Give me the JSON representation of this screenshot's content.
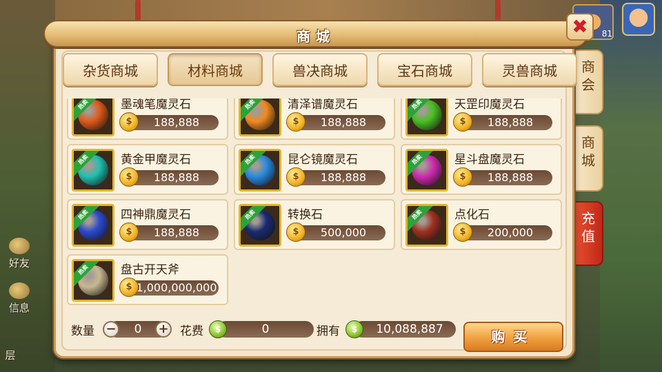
{
  "window": {
    "title": "商城",
    "close_symbol": "✖"
  },
  "background": {
    "level": "81",
    "side_icons": [
      "好友",
      "信息",
      "层"
    ]
  },
  "tabs": [
    {
      "label": "杂货商城",
      "active": false
    },
    {
      "label": "材料商城",
      "active": true
    },
    {
      "label": "兽决商城",
      "active": false
    },
    {
      "label": "宝石商城",
      "active": false
    },
    {
      "label": "灵兽商城",
      "active": false
    }
  ],
  "side_tabs": [
    {
      "label": "商会",
      "active": false
    },
    {
      "label": "商城",
      "active": false
    },
    {
      "label": "充值",
      "active": true
    }
  ],
  "items": [
    {
      "name": "墨魂笔魔灵石",
      "price": "188,888",
      "badge": "热卖",
      "color": "#e05a1a"
    },
    {
      "name": "清泽谱魔灵石",
      "price": "188,888",
      "badge": "热卖",
      "color": "#f08a20"
    },
    {
      "name": "天罡印魔灵石",
      "price": "188,888",
      "badge": "热卖",
      "color": "#4ac020"
    },
    {
      "name": "黄金甲魔灵石",
      "price": "188,888",
      "badge": "热卖",
      "color": "#20c0b0"
    },
    {
      "name": "昆仑镜魔灵石",
      "price": "188,888",
      "badge": "热卖",
      "color": "#2a8ae0"
    },
    {
      "name": "星斗盘魔灵石",
      "price": "188,888",
      "badge": "热卖",
      "color": "#d02ab0"
    },
    {
      "name": "四神鼎魔灵石",
      "price": "188,888",
      "badge": "热卖",
      "color": "#2a4ad0"
    },
    {
      "name": "转换石",
      "price": "500,000",
      "badge": "热卖",
      "color": "#1a2a70"
    },
    {
      "name": "点化石",
      "price": "200,000",
      "badge": "热卖",
      "color": "#a03020"
    },
    {
      "name": "盘古开天斧",
      "price": "1,000,000,000",
      "badge": "热卖",
      "color": "#c8b890"
    }
  ],
  "coin_symbol": "$",
  "bottom": {
    "quantity_label": "数量",
    "quantity_value": "0",
    "minus": "−",
    "plus": "+",
    "cost_label": "花费",
    "cost_value": "0",
    "owned_label": "拥有",
    "owned_value": "10,088,887",
    "money_symbol": "$",
    "buy_label": "购买"
  }
}
